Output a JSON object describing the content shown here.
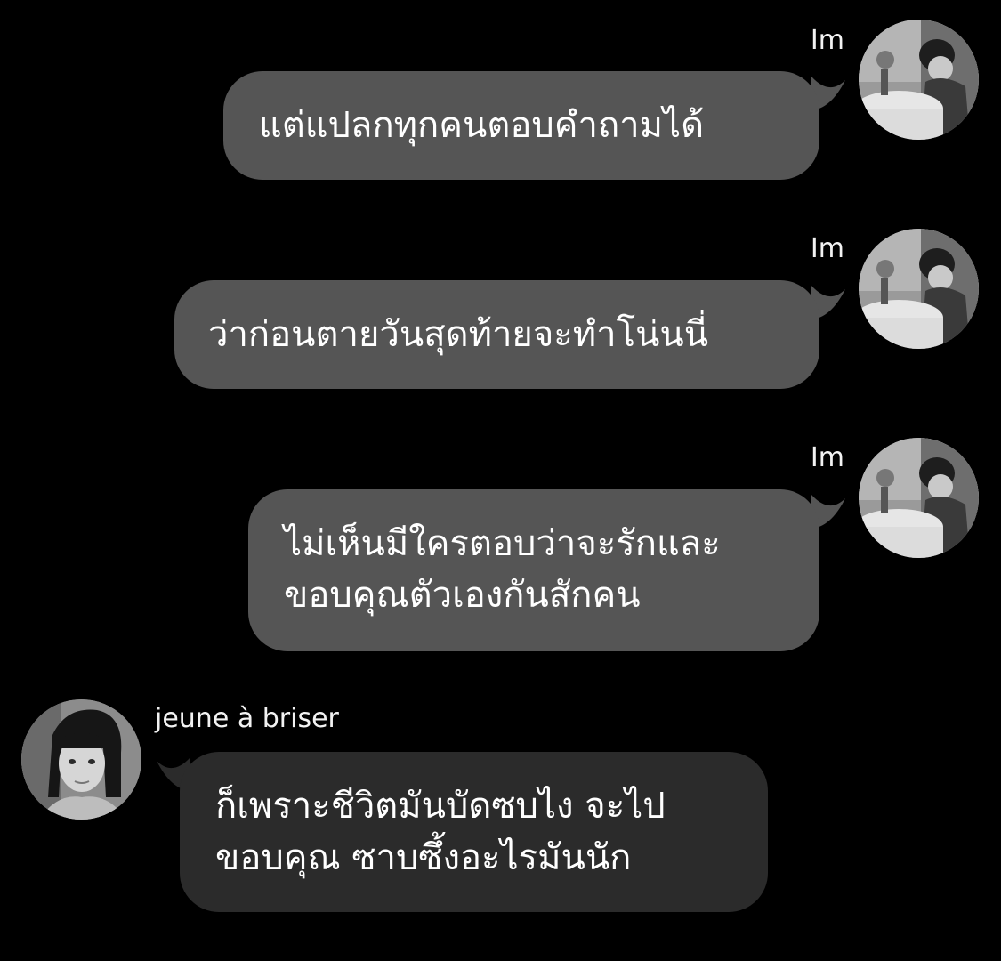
{
  "conversation": {
    "messages": [
      {
        "sender": "Im",
        "direction": "outgoing",
        "lines": [
          "แต่แปลกทุกคนตอบคำถามได้"
        ]
      },
      {
        "sender": "Im",
        "direction": "outgoing",
        "lines": [
          "ว่าก่อนตายวันสุดท้ายจะทำโน่นนี่"
        ]
      },
      {
        "sender": "Im",
        "direction": "outgoing",
        "lines": [
          "ไม่เห็นมีใครตอบว่าจะรักและ",
          "ขอบคุณตัวเองกันสักคน"
        ]
      },
      {
        "sender": "jeune à briser",
        "direction": "incoming",
        "lines": [
          "ก็เพราะชีวิตมันบัดซบไง จะไป",
          "ขอบคุณ ซาบซึ้งอะไรมันนัก"
        ]
      }
    ]
  },
  "colors": {
    "background": "#000000",
    "outgoing_bubble": "#555555",
    "incoming_bubble": "#2b2b2b",
    "text": "#ffffff"
  },
  "icons": {
    "avatar_im": "avatar-photo-woman-at-table",
    "avatar_jeune": "avatar-photo-woman-portrait"
  }
}
